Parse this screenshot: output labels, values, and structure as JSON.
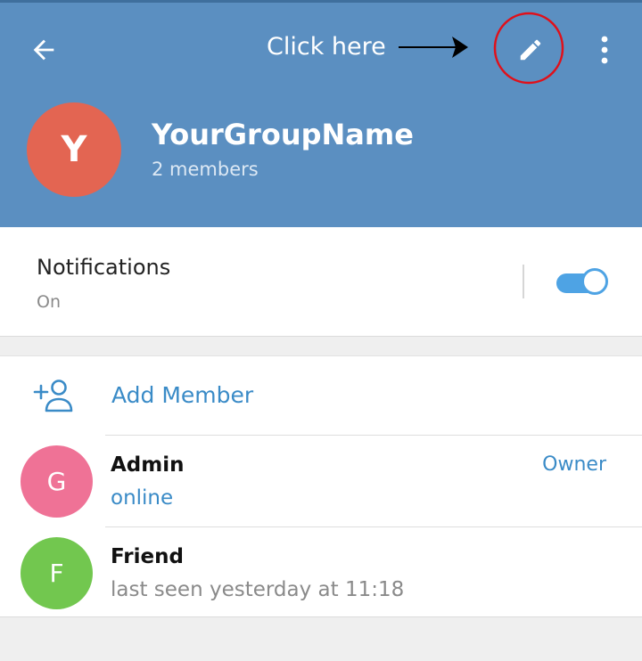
{
  "header": {
    "annotation_text": "Click here",
    "group_initial": "Y",
    "group_name": "YourGroupName",
    "members_count": "2 members",
    "colors": {
      "background": "#5b8fc1",
      "annotation_circle": "#e0101a",
      "avatar": "#e36552"
    },
    "icons": [
      "back-arrow-icon",
      "pencil-icon",
      "more-vertical-icon"
    ]
  },
  "notifications": {
    "title": "Notifications",
    "status": "On",
    "enabled": true,
    "accent": "#4ea3e4"
  },
  "members_section": {
    "add_member_label": "Add Member",
    "add_member_icon": "add-person-icon",
    "members": [
      {
        "initial": "G",
        "name": "Admin",
        "status": "online",
        "status_color": "#3a8bc7",
        "role": "Owner",
        "avatar_color": "#ef7296"
      },
      {
        "initial": "F",
        "name": "Friend",
        "status": "last seen yesterday at 11:18",
        "status_color": "#8a8a8a",
        "role": "",
        "avatar_color": "#72c74f"
      }
    ]
  }
}
